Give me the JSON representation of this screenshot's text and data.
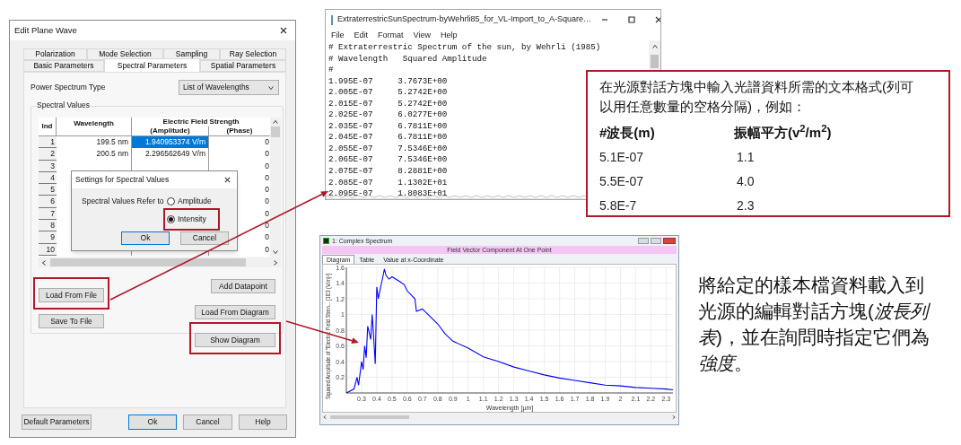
{
  "edit_dialog": {
    "title": "Edit Plane Wave",
    "tabs_row1": [
      {
        "label": "Polarization",
        "selected": false
      },
      {
        "label": "Mode Selection",
        "selected": false
      },
      {
        "label": "Sampling",
        "selected": false
      },
      {
        "label": "Ray Selection",
        "selected": false
      }
    ],
    "tabs_row2": [
      {
        "label": "Basic Parameters",
        "selected": false
      },
      {
        "label": "Spectral Parameters",
        "selected": true
      },
      {
        "label": "Spatial Parameters",
        "selected": false
      }
    ],
    "power_spectrum_label": "Power Spectrum Type",
    "power_spectrum_value": "List of Wavelengths",
    "group_label": "Spectral Values",
    "table": {
      "columns": [
        "Ind",
        "Wavelength",
        "Electric Field Strength"
      ],
      "subcolumns": [
        "(Amplitude)",
        "(Phase)"
      ],
      "rows": [
        {
          "ind": "1",
          "wavelength": "199.5 nm",
          "amplitude": "1.940953374 V/m",
          "phase": "0",
          "selected": true
        },
        {
          "ind": "2",
          "wavelength": "200.5 nm",
          "amplitude": "2.296562649 V/m",
          "phase": "0",
          "selected": false
        },
        {
          "ind": "3",
          "phase": "0",
          "selected": false
        },
        {
          "ind": "4",
          "phase": "0",
          "selected": false
        },
        {
          "ind": "5",
          "phase": "0",
          "selected": false
        },
        {
          "ind": "6",
          "phase": "0",
          "selected": false
        },
        {
          "ind": "7",
          "phase": "0",
          "selected": false
        },
        {
          "ind": "8",
          "phase": "0",
          "selected": false
        },
        {
          "ind": "9",
          "phase": "0",
          "selected": false
        },
        {
          "ind": "10",
          "phase": "0",
          "selected": false
        }
      ]
    },
    "action_buttons": [
      {
        "label": "Add Datapoint",
        "highlighted": false
      },
      {
        "label": "Load From File",
        "highlighted": true
      },
      {
        "label": "Save To File",
        "highlighted": false
      },
      {
        "label": "Load From Diagram",
        "highlighted": false
      },
      {
        "label": "Show Diagram",
        "highlighted": true
      }
    ],
    "footer_buttons": [
      {
        "label": "Default Parameters",
        "default": false
      },
      {
        "label": "Ok",
        "default": true
      },
      {
        "label": "Cancel",
        "default": false
      },
      {
        "label": "Help",
        "default": false
      }
    ]
  },
  "settings_dialog": {
    "title": "Settings for Spectral Values",
    "label": "Spectral Values Refer to",
    "options": [
      {
        "label": "Amplitude",
        "selected": false,
        "highlighted": false
      },
      {
        "label": "Intensity",
        "selected": true,
        "highlighted": true
      }
    ],
    "buttons": [
      {
        "label": "Ok",
        "default": true
      },
      {
        "label": "Cancel",
        "default": false
      }
    ]
  },
  "notepad": {
    "title": "ExtraterrestricSunSpectrum-byWehrli85_for_VL-Import_to_A-Square…",
    "menu": [
      "File",
      "Edit",
      "Format",
      "View",
      "Help"
    ],
    "lines": [
      "# Extraterrestric Spectrum of the sun, by Wehrli (1985)",
      "# Wavelength   Squared Amplitude",
      "#",
      "1.995E-07     3.7673E+00",
      "2.005E-07     5.2742E+00",
      "2.015E-07     5.2742E+00",
      "2.025E-07     6.0277E+00",
      "2.035E-07     6.7811E+00",
      "2.045E-07     6.7811E+00",
      "2.055E-07     7.5346E+00",
      "2.065E-07     7.5346E+00",
      "2.075E-07     8.2881E+00",
      "2.085E-07     1.1302E+01",
      "2.095E-07     1.8083E+01"
    ]
  },
  "callout": {
    "text": "在光源對話方塊中輸入光譜資料所需的文本格式(列可以用任意數量的空格分隔)，例如：",
    "headers": [
      "#波長(m)",
      "振幅平方(v$^{2}$/m$^{2}$)"
    ],
    "rows": [
      {
        "wavelength": "5.1E-07",
        "amplitude_squared": "1.1"
      },
      {
        "wavelength": "5.5E-07",
        "amplitude_squared": "4.0"
      },
      {
        "wavelength": "5.8E-7",
        "amplitude_squared": "2.3"
      }
    ]
  },
  "spectrum_window": {
    "title": "1: Complex Spectrum",
    "header": "Field Vector Component At One Point",
    "tabs": [
      {
        "label": "Diagram",
        "selected": true
      },
      {
        "label": "Table",
        "selected": false
      },
      {
        "label": "Value at x-Coordinate",
        "selected": false
      }
    ],
    "chart_data": {
      "type": "line",
      "grid": true,
      "xlabel": "Wavelength [µm]",
      "ylabel": "Squared Amplitude of \"Electric Field Stren... [1E3 (V/m)²]",
      "x": [
        0.2,
        0.25,
        0.27,
        0.28,
        0.3,
        0.31,
        0.32,
        0.33,
        0.34,
        0.36,
        0.37,
        0.38,
        0.39,
        0.4,
        0.41,
        0.42,
        0.44,
        0.45,
        0.46,
        0.48,
        0.5,
        0.55,
        0.58,
        0.6,
        0.65,
        0.66,
        0.7,
        0.8,
        0.85,
        0.9,
        1.0,
        1.1,
        1.2,
        1.3,
        1.4,
        1.5,
        1.6,
        1.7,
        1.8,
        1.9,
        2.0,
        2.1,
        2.2,
        2.3,
        2.345
      ],
      "series": [
        {
          "color": "#0000ff",
          "values": [
            0,
            0.05,
            0.2,
            0.1,
            0.4,
            0.3,
            0.6,
            0.45,
            0.85,
            0.68,
            1.0,
            0.7,
            0.37,
            1.35,
            1.2,
            1.3,
            1.48,
            1.58,
            1.5,
            1.45,
            1.48,
            1.42,
            1.38,
            1.3,
            1.2,
            1.04,
            1.07,
            0.88,
            0.75,
            0.66,
            0.57,
            0.46,
            0.4,
            0.33,
            0.28,
            0.23,
            0.19,
            0.16,
            0.13,
            0.1,
            0.09,
            0.07,
            0.06,
            0.05,
            0.04
          ]
        }
      ],
      "xlim": [
        0.2,
        2.345
      ],
      "ylim": [
        0,
        1.6
      ],
      "xticks": [
        {
          "value": 0.3,
          "label": "0.3"
        },
        {
          "value": 0.4,
          "label": "0.4"
        },
        {
          "value": 0.5,
          "label": "0.5"
        },
        {
          "value": 0.6,
          "label": "0.6"
        },
        {
          "value": 0.7,
          "label": "0.7"
        },
        {
          "value": 0.8,
          "label": "0.8"
        },
        {
          "value": 0.9,
          "label": "0.9"
        },
        {
          "value": 1,
          "label": "1"
        },
        {
          "value": 1.1,
          "label": "1.1"
        },
        {
          "value": 1.2,
          "label": "1.2"
        },
        {
          "value": 1.3,
          "label": "1.3"
        },
        {
          "value": 1.4,
          "label": "1.4"
        },
        {
          "value": 1.5,
          "label": "1.5"
        },
        {
          "value": 1.6,
          "label": "1.6"
        },
        {
          "value": 1.7,
          "label": "1.7"
        },
        {
          "value": 1.8,
          "label": "1.8"
        },
        {
          "value": 1.9,
          "label": "1.9"
        },
        {
          "value": 2,
          "label": "2"
        },
        {
          "value": 2.1,
          "label": "2.1"
        },
        {
          "value": 2.2,
          "label": "2.2"
        },
        {
          "value": 2.3,
          "label": "2.3"
        }
      ],
      "yticks": [
        {
          "value": 0.2,
          "label": "0.2"
        },
        {
          "value": 0.4,
          "label": "0.4"
        },
        {
          "value": 0.6,
          "label": "0.6"
        },
        {
          "value": 0.8,
          "label": "0.8"
        },
        {
          "value": 1,
          "label": "1"
        },
        {
          "value": 1.2,
          "label": "1.2"
        },
        {
          "value": 1.4,
          "label": "1.4"
        },
        {
          "value": 1.6,
          "label": "1.6"
        }
      ]
    }
  },
  "caption": [
    {
      "text": "將給定的樣本檔資料載入到光源的編輯對話方塊(",
      "italic": false
    },
    {
      "text": "波長列表",
      "italic": true
    },
    {
      "text": ")，並在詢問時指定它們為",
      "italic": false
    },
    {
      "text": "強度",
      "italic": true
    },
    {
      "text": "。",
      "italic": false
    }
  ]
}
